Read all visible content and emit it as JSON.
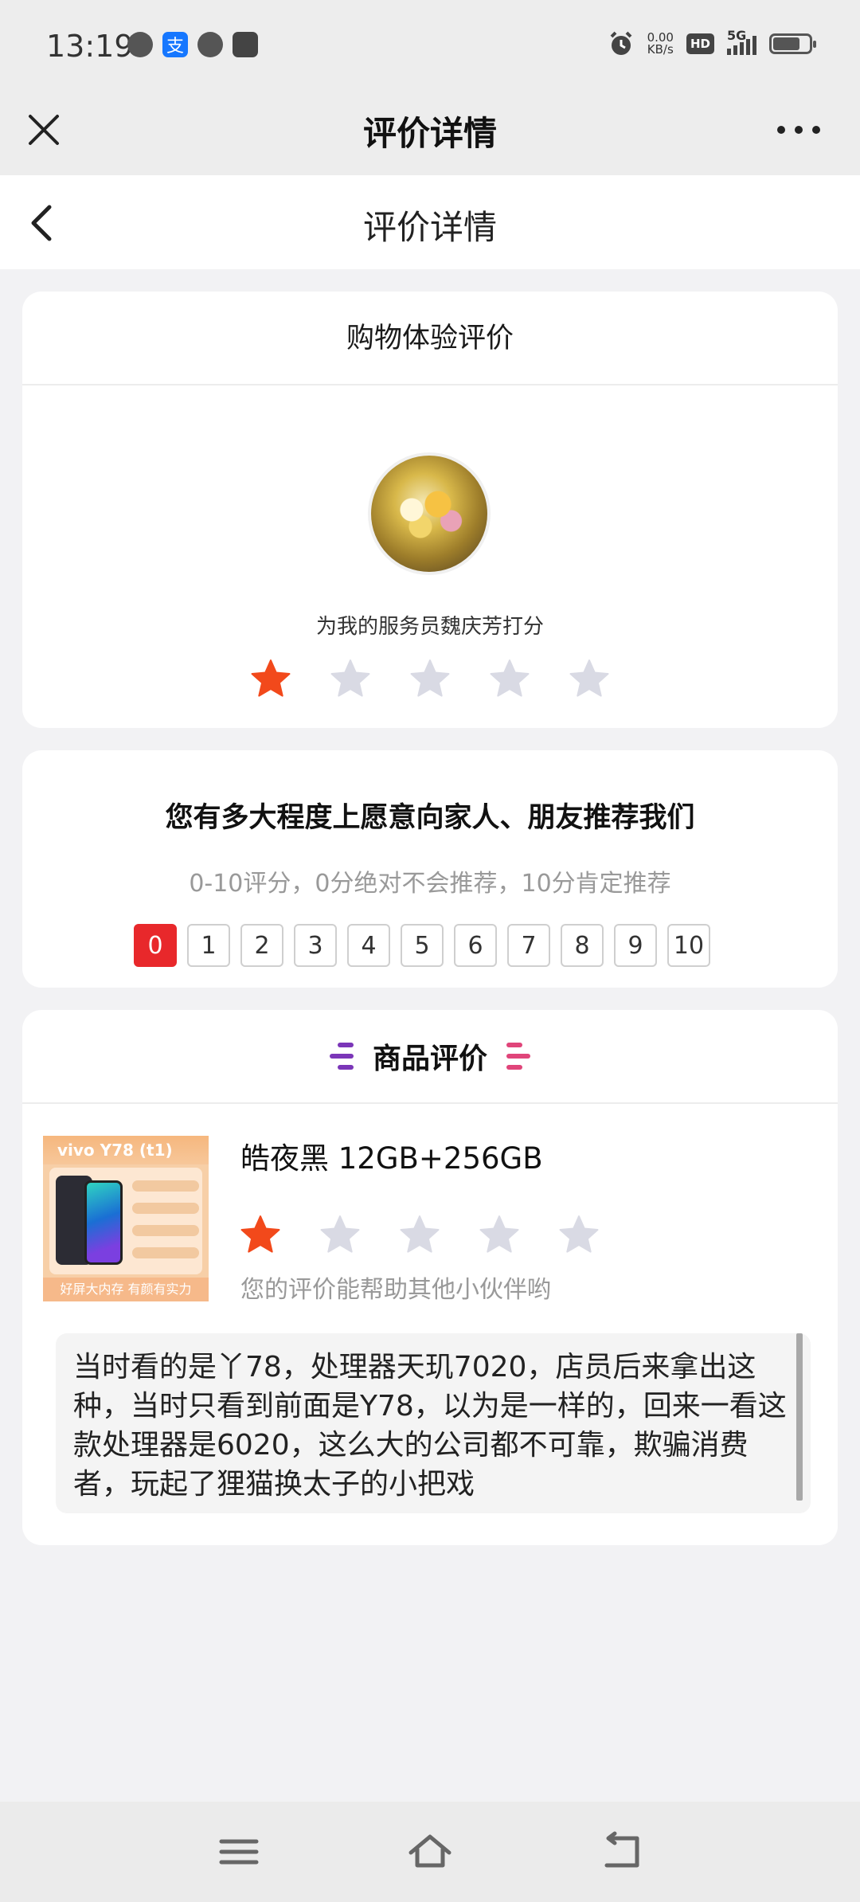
{
  "status_bar": {
    "time": "13:19",
    "net_speed_value": "0.00",
    "net_speed_unit": "KB/s",
    "hd": "HD",
    "signal": "5G",
    "battery_level": 0.75,
    "alipay_glyph": "支"
  },
  "title_bar": {
    "title": "评价详情"
  },
  "page_header": {
    "title": "评价详情"
  },
  "shopping_card": {
    "title": "购物体验评价",
    "rate_text": "为我的服务员魏庆芳打分",
    "rating": 1,
    "max_rating": 5
  },
  "nps_card": {
    "question": "您有多大程度上愿意向家人、朋友推荐我们",
    "hint": "0-10评分，0分绝对不会推荐，10分肯定推荐",
    "scale": [
      "0",
      "1",
      "2",
      "3",
      "4",
      "5",
      "6",
      "7",
      "8",
      "9",
      "10"
    ],
    "selected": 0
  },
  "product_card": {
    "section_title": "商品评价",
    "product_image_title": "vivo Y78 (t1)",
    "product_image_footer": "好屏大内存 有颜有实力",
    "product_name": "皓夜黑 12GB+256GB",
    "rating": 1,
    "hint": "您的评价能帮助其他小伙伴哟",
    "review": "当时看的是丫78，处理器天玑7020，店员后来拿出这种，当时只看到前面是Y78，以为是一样的，回来一看这款处理器是6020，这么大的公司都不可靠，欺骗消费者，玩起了狸猫换太子的小把戏"
  },
  "colors": {
    "star_active": "#f2491b",
    "star_inactive": "#d9dae4",
    "nps_selected": "#e8282b",
    "deco_left": "#7b36b8",
    "deco_right": "#e0457a"
  },
  "icons": {
    "close": "close-icon",
    "more": "more-icon",
    "back": "back-icon",
    "star": "star-icon",
    "menu": "menu-icon",
    "home": "home-icon",
    "back_nav": "back-nav-icon"
  }
}
